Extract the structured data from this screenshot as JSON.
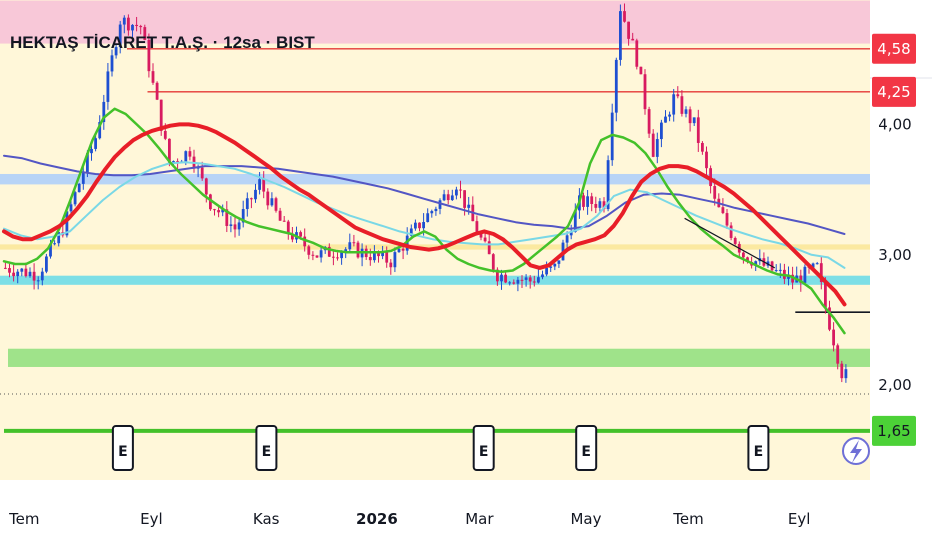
{
  "chart_data": {
    "type": "candlestick",
    "title": "HEKTAŞ TİCARET T.A.Ş. · 12sa · BIST",
    "currency": "TRY",
    "x_ticks": [
      {
        "label": "Tem",
        "idx": 3,
        "bold": false
      },
      {
        "label": "Eyl",
        "idx": 34,
        "bold": false
      },
      {
        "label": "Kas",
        "idx": 62,
        "bold": false
      },
      {
        "label": "2026",
        "idx": 89,
        "bold": true
      },
      {
        "label": "Mar",
        "idx": 114,
        "bold": false
      },
      {
        "label": "May",
        "idx": 140,
        "bold": false
      },
      {
        "label": "Tem",
        "idx": 165,
        "bold": false
      },
      {
        "label": "Eyl",
        "idx": 192,
        "bold": false
      }
    ],
    "y_ticks": [
      {
        "label": "4,00",
        "value": 4.0
      },
      {
        "label": "3,00",
        "value": 3.0
      },
      {
        "label": "2,00",
        "value": 2.0
      }
    ],
    "ylim": [
      1.35,
      4.9
    ],
    "price_tags": [
      {
        "label": "4,58",
        "value": 4.58,
        "color": "#f23645",
        "text_color": "#ffffff"
      },
      {
        "label": "4,25",
        "value": 4.25,
        "color": "#f23645",
        "text_color": "#ffffff"
      },
      {
        "label": "1,65",
        "value": 1.65,
        "color": "#4cd137",
        "text_color": "#131722"
      }
    ],
    "horizontal_lines": [
      {
        "value": 4.58,
        "color": "#e53935",
        "from_idx": 30
      },
      {
        "value": 4.25,
        "color": "#e53935",
        "from_idx": 35
      },
      {
        "value": 1.65,
        "color": "#44c12a",
        "from_idx": 0
      },
      {
        "value": 2.56,
        "color": "#131722",
        "from_idx": 193
      }
    ],
    "zones": [
      {
        "from": 4.62,
        "to": 4.95,
        "color": "#f8c8d8"
      },
      {
        "from": 3.54,
        "to": 3.62,
        "color": "#b8d4f6"
      },
      {
        "from": 3.04,
        "to": 3.08,
        "color": "#fbe9a0"
      },
      {
        "from": 2.77,
        "to": 2.84,
        "color": "#7ddfe6"
      },
      {
        "from": 2.14,
        "to": 2.28,
        "color": "#9fe38a"
      }
    ],
    "event_markers": [
      {
        "label": "E",
        "idx": 29
      },
      {
        "label": "E",
        "idx": 64
      },
      {
        "label": "E",
        "idx": 117
      },
      {
        "label": "E",
        "idx": 142
      },
      {
        "label": "E",
        "idx": 184
      }
    ],
    "series": [
      {
        "name": "",
        "color": "#e81e28",
        "width": 4,
        "values": [
          3.18,
          3.14,
          3.12,
          3.12,
          3.15,
          3.18,
          3.22,
          3.28,
          3.36,
          3.45,
          3.56,
          3.66,
          3.75,
          3.82,
          3.88,
          3.92,
          3.95,
          3.97,
          3.99,
          4.0,
          4.0,
          3.99,
          3.97,
          3.94,
          3.9,
          3.86,
          3.81,
          3.76,
          3.71,
          3.66,
          3.6,
          3.55,
          3.5,
          3.46,
          3.41,
          3.36,
          3.31,
          3.26,
          3.21,
          3.18,
          3.15,
          3.12,
          3.1,
          3.08,
          3.06,
          3.05,
          3.04,
          3.05,
          3.07,
          3.1,
          3.13,
          3.16,
          3.18,
          3.16,
          3.12,
          3.06,
          2.99,
          2.92,
          2.9,
          2.92,
          2.98,
          3.04,
          3.08,
          3.1,
          3.12,
          3.15,
          3.22,
          3.32,
          3.45,
          3.56,
          3.62,
          3.66,
          3.68,
          3.68,
          3.67,
          3.64,
          3.6,
          3.56,
          3.52,
          3.47,
          3.41,
          3.35,
          3.28,
          3.21,
          3.14,
          3.07,
          3.0,
          2.93,
          2.86,
          2.79,
          2.72,
          2.62
        ]
      },
      {
        "name": "",
        "color": "#44c12a",
        "width": 2.5,
        "values": [
          2.95,
          2.93,
          2.93,
          2.97,
          3.05,
          3.2,
          3.42,
          3.65,
          3.88,
          4.05,
          4.12,
          4.08,
          4.0,
          3.92,
          3.82,
          3.71,
          3.62,
          3.54,
          3.46,
          3.4,
          3.34,
          3.29,
          3.25,
          3.22,
          3.2,
          3.18,
          3.16,
          3.12,
          3.09,
          3.05,
          3.03,
          3.02,
          3.02,
          3.02,
          3.02,
          3.03,
          3.07,
          3.14,
          3.18,
          3.14,
          3.04,
          2.97,
          2.93,
          2.9,
          2.88,
          2.87,
          2.88,
          2.93,
          3.0,
          3.07,
          3.14,
          3.22,
          3.4,
          3.7,
          3.88,
          3.92,
          3.9,
          3.86,
          3.78,
          3.66,
          3.52,
          3.4,
          3.29,
          3.2,
          3.13,
          3.07,
          3.0,
          2.96,
          2.92,
          2.88,
          2.85,
          2.84,
          2.8,
          2.74,
          2.62,
          2.52,
          2.4
        ]
      },
      {
        "name": "",
        "color": "#7ad8e6",
        "width": 2,
        "values": [
          3.2,
          3.15,
          3.12,
          3.14,
          3.18,
          3.3,
          3.42,
          3.52,
          3.6,
          3.66,
          3.7,
          3.71,
          3.7,
          3.68,
          3.66,
          3.62,
          3.57,
          3.52,
          3.46,
          3.4,
          3.35,
          3.3,
          3.26,
          3.22,
          3.18,
          3.15,
          3.12,
          3.1,
          3.09,
          3.08,
          3.08,
          3.1,
          3.12,
          3.14,
          3.16,
          3.2,
          3.3,
          3.45,
          3.5,
          3.48,
          3.42,
          3.36,
          3.3,
          3.25,
          3.2,
          3.16,
          3.12,
          3.09,
          3.05,
          3.0,
          2.98,
          2.9
        ]
      },
      {
        "name": "",
        "color": "#5356c4",
        "width": 2,
        "values": [
          3.76,
          3.74,
          3.7,
          3.67,
          3.64,
          3.62,
          3.61,
          3.61,
          3.62,
          3.64,
          3.66,
          3.68,
          3.68,
          3.68,
          3.67,
          3.66,
          3.64,
          3.62,
          3.6,
          3.57,
          3.54,
          3.51,
          3.47,
          3.43,
          3.39,
          3.35,
          3.31,
          3.28,
          3.25,
          3.23,
          3.22,
          3.2,
          3.22,
          3.3,
          3.4,
          3.46,
          3.47,
          3.46,
          3.43,
          3.4,
          3.36,
          3.33,
          3.3,
          3.27,
          3.24,
          3.2,
          3.16
        ]
      }
    ]
  },
  "icons": {
    "flash": "lightning-icon"
  }
}
